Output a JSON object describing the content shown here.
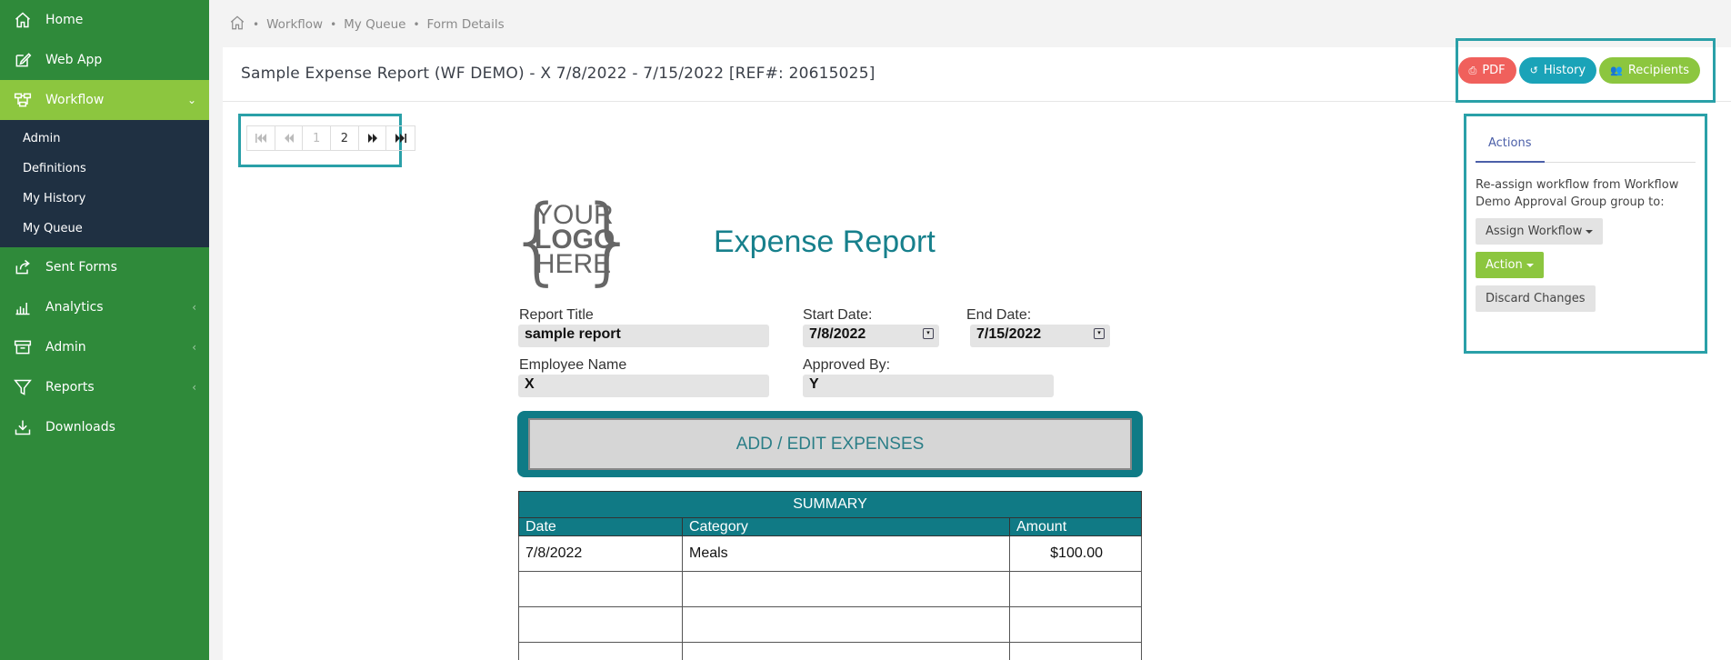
{
  "sidebar": {
    "items": [
      {
        "label": "Home",
        "icon": "home-icon"
      },
      {
        "label": "Web App",
        "icon": "edit-icon"
      },
      {
        "label": "Workflow",
        "icon": "workflow-icon"
      },
      {
        "label": "Sent Forms",
        "icon": "share-icon"
      },
      {
        "label": "Analytics",
        "icon": "bar-chart-icon"
      },
      {
        "label": "Admin",
        "icon": "archive-icon"
      },
      {
        "label": "Reports",
        "icon": "filter-icon"
      },
      {
        "label": "Downloads",
        "icon": "download-icon"
      }
    ],
    "submenu": [
      "Admin",
      "Definitions",
      "My History",
      "My Queue"
    ],
    "active_color": "#8cc63f",
    "bg_color": "#2f8a3a"
  },
  "breadcrumb": [
    "Workflow",
    "My Queue",
    "Form Details"
  ],
  "header": {
    "title": "Sample Expense Report (WF DEMO) - X 7/8/2022 - 7/15/2022 [REF#: 20615025]",
    "buttons": {
      "pdf": "PDF",
      "history": "History",
      "recipients": "Recipients"
    }
  },
  "pager": {
    "pages": [
      "1",
      "2"
    ],
    "current": "1"
  },
  "form": {
    "logo": {
      "line1": "YOUR",
      "line2": "LOGO",
      "line3": "HERE"
    },
    "title": "Expense Report",
    "report_title_label": "Report Title",
    "report_title_value": "sample report",
    "start_date_label": "Start Date:",
    "start_date_value": "7/8/2022",
    "end_date_label": "End Date:",
    "end_date_value": "7/15/2022",
    "employee_label": "Employee Name",
    "employee_value": "X",
    "approved_label": "Approved By:",
    "approved_value": "Y",
    "add_button": "ADD / EDIT EXPENSES",
    "summary": {
      "caption": "SUMMARY",
      "columns": [
        "Date",
        "Category",
        "Amount"
      ],
      "rows": [
        [
          "7/8/2022",
          "Meals",
          "$100.00"
        ],
        [
          "",
          "",
          ""
        ],
        [
          "",
          "",
          ""
        ],
        [
          "",
          "",
          ""
        ]
      ]
    }
  },
  "actions": {
    "tab": "Actions",
    "reassign_text": "Re-assign workflow from Workflow Demo Approval Group group to:",
    "assign_button": "Assign Workflow",
    "action_button": "Action",
    "discard_button": "Discard Changes"
  }
}
